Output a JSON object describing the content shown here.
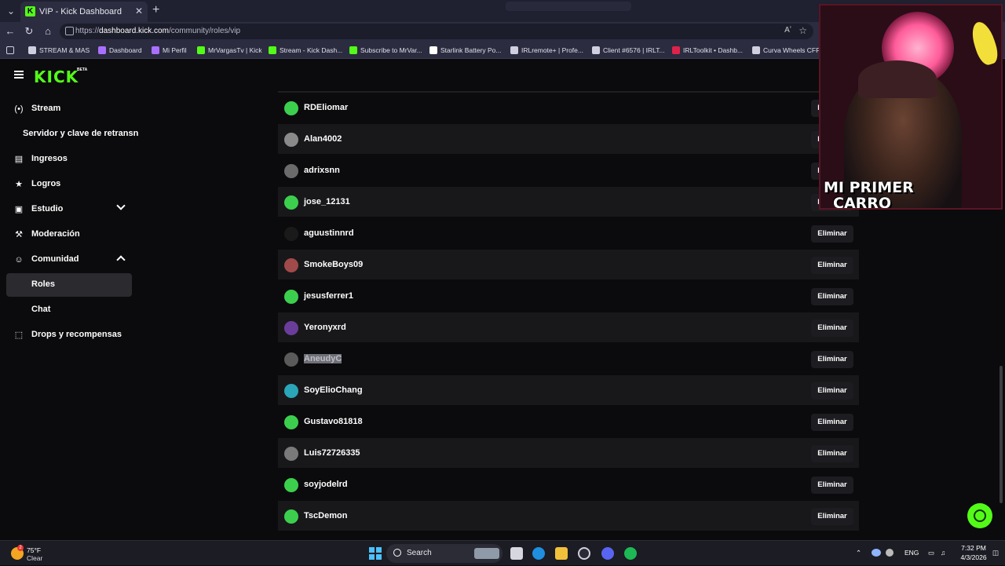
{
  "browser": {
    "tab_title": "VIP - Kick Dashboard",
    "tab_favicon": "K",
    "url_prefix": "https://",
    "url_domain": "dashboard.kick.com",
    "url_path": "/community/roles/vip",
    "read_aloud": "Aʼ",
    "bookmarks": [
      {
        "label": "STREAM & MAS",
        "icon": "folder-icon",
        "color": "#cfcfe0"
      },
      {
        "label": "Dashboard",
        "icon": "twitch-icon",
        "color": "#a970ff"
      },
      {
        "label": "Mi Perfil",
        "icon": "twitch-icon",
        "color": "#a970ff"
      },
      {
        "label": "MrVargasTv | Kick",
        "icon": "kick-icon",
        "color": "#53fc18"
      },
      {
        "label": "Stream - Kick Dash...",
        "icon": "kick-icon",
        "color": "#53fc18"
      },
      {
        "label": "Subscribe to MrVar...",
        "icon": "kick-icon",
        "color": "#53fc18"
      },
      {
        "label": "Starlink Battery Po...",
        "icon": "page-icon",
        "color": "#ffffff"
      },
      {
        "label": "IRLremote+ | Profe...",
        "icon": "globe-icon",
        "color": "#cfcfe0"
      },
      {
        "label": "Client #6576 | IRLT...",
        "icon": "globe-icon",
        "color": "#cfcfe0"
      },
      {
        "label": "IRLToolkit • Dashb...",
        "icon": "irltoolkit-icon",
        "color": "#e0224a"
      },
      {
        "label": "Curva Wheels CFF76",
        "icon": "wheel-icon",
        "color": "#cfcfe0"
      }
    ]
  },
  "app": {
    "logo": "KICK",
    "beta": "BETA"
  },
  "sidebar": {
    "items": [
      {
        "label": "Stream",
        "icon": "broadcast-icon",
        "glyph": "(•)"
      },
      {
        "label": "Servidor y clave de retransn",
        "icon": "",
        "glyph": ""
      },
      {
        "label": "Ingresos",
        "icon": "revenue-icon",
        "glyph": "▤"
      },
      {
        "label": "Logros",
        "icon": "trophy-icon",
        "glyph": "★"
      },
      {
        "label": "Estudio",
        "icon": "studio-icon",
        "glyph": "▣"
      },
      {
        "label": "Moderación",
        "icon": "wrench-icon",
        "glyph": "⚒"
      },
      {
        "label": "Comunidad",
        "icon": "community-icon",
        "glyph": "☺"
      },
      {
        "label": "Roles",
        "icon": "",
        "glyph": ""
      },
      {
        "label": "Chat",
        "icon": "",
        "glyph": ""
      },
      {
        "label": "Drops y recompensas",
        "icon": "gift-icon",
        "glyph": "⬚"
      }
    ]
  },
  "vip_list": {
    "remove_label": "Eliminar",
    "users": [
      {
        "name": "RDEliomar",
        "avatar": "#3ccf4e"
      },
      {
        "name": "Alan4002",
        "avatar": "#8a8a8a"
      },
      {
        "name": "adrixsnn",
        "avatar": "#6b6b6b"
      },
      {
        "name": "jose_12131",
        "avatar": "#3ccf4e"
      },
      {
        "name": "aguustinnrd",
        "avatar": "#1a1a1a"
      },
      {
        "name": "SmokeBoys09",
        "avatar": "#a04a4a"
      },
      {
        "name": "jesusferrer1",
        "avatar": "#3ccf4e"
      },
      {
        "name": "Yeronyxrd",
        "avatar": "#6a3d9a"
      },
      {
        "name": "AneudyC",
        "avatar": "#5a5a5a"
      },
      {
        "name": "SoyElioChang",
        "avatar": "#2aa6b8"
      },
      {
        "name": "Gustavo81818",
        "avatar": "#3ccf4e"
      },
      {
        "name": "Luis72726335",
        "avatar": "#7a7a7a"
      },
      {
        "name": "soyjodelrd",
        "avatar": "#3ccf4e"
      },
      {
        "name": "TscDemon",
        "avatar": "#3ccf4e"
      }
    ]
  },
  "overlay": {
    "caption_line1": "MI PRIMER",
    "caption_line2": "CARRO"
  },
  "taskbar": {
    "temp": "75°F",
    "condition": "Clear",
    "weather_badge": "2",
    "search_label": "Search",
    "lang": "ENG",
    "time": "7:32 PM",
    "date": "4/3/2026"
  },
  "colors": {
    "brand": "#53fc18",
    "row_alt": "#18181b",
    "active_nav": "#2b2b2f"
  }
}
